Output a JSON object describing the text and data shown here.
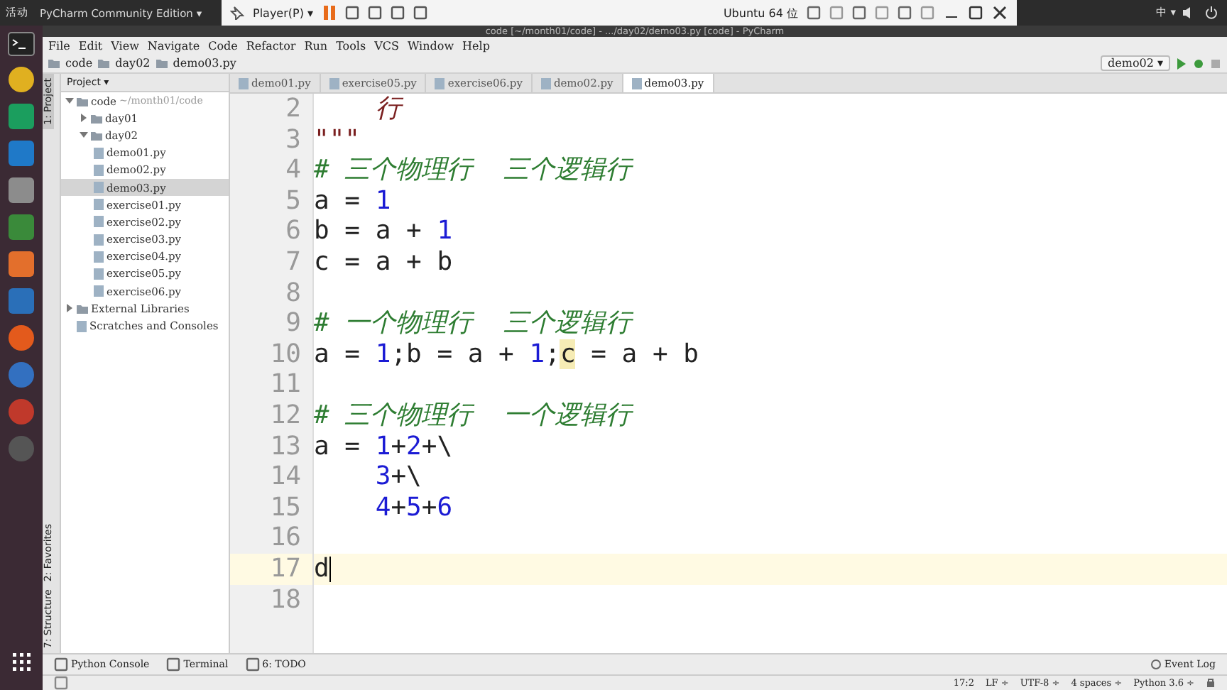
{
  "top_bar": {
    "activities": "活动",
    "app_menu": "PyCharm Community Edition ▾",
    "input_method": "中 ▾"
  },
  "vm_toolbar": {
    "player": "Player(P) ▾",
    "vm_name": "Ubuntu 64 位"
  },
  "window": {
    "title": "code [~/month01/code] - .../day02/demo03.py [code] - PyCharm"
  },
  "menu": [
    "File",
    "Edit",
    "View",
    "Navigate",
    "Code",
    "Refactor",
    "Run",
    "Tools",
    "VCS",
    "Window",
    "Help"
  ],
  "breadcrumb": [
    "code",
    "day02",
    "demo03.py"
  ],
  "run_config": "demo02 ▾",
  "project_header": "Project ▾",
  "side_tabs_left_top": [
    {
      "label": "1: Project",
      "selected": true
    }
  ],
  "side_tabs_left_bottom": [
    {
      "label": "2: Favorites",
      "selected": false
    },
    {
      "label": "7: Structure",
      "selected": false
    }
  ],
  "tree": [
    {
      "label": "code",
      "hint": "~/month01/code",
      "kind": "folder",
      "expanded": true,
      "selected": false,
      "children": [
        {
          "label": "day01",
          "kind": "folder",
          "expanded": false,
          "selected": false
        },
        {
          "label": "day02",
          "kind": "folder",
          "expanded": true,
          "selected": false,
          "children": [
            {
              "label": "demo01.py",
              "kind": "file",
              "selected": false
            },
            {
              "label": "demo02.py",
              "kind": "file",
              "selected": false
            },
            {
              "label": "demo03.py",
              "kind": "file",
              "selected": true
            },
            {
              "label": "exercise01.py",
              "kind": "file",
              "selected": false
            },
            {
              "label": "exercise02.py",
              "kind": "file",
              "selected": false
            },
            {
              "label": "exercise03.py",
              "kind": "file",
              "selected": false
            },
            {
              "label": "exercise04.py",
              "kind": "file",
              "selected": false
            },
            {
              "label": "exercise05.py",
              "kind": "file",
              "selected": false
            },
            {
              "label": "exercise06.py",
              "kind": "file",
              "selected": false
            }
          ]
        }
      ]
    },
    {
      "label": "External Libraries",
      "kind": "library",
      "expanded": false,
      "selected": false
    },
    {
      "label": "Scratches and Consoles",
      "kind": "scratch",
      "selected": false
    }
  ],
  "tabs": [
    {
      "label": "demo01.py",
      "selected": false
    },
    {
      "label": "exercise05.py",
      "selected": false
    },
    {
      "label": "exercise06.py",
      "selected": false
    },
    {
      "label": "demo02.py",
      "selected": false
    },
    {
      "label": "demo03.py",
      "selected": true
    }
  ],
  "code_lines": [
    {
      "number": "2",
      "current": false,
      "tokens": [
        {
          "kind": "string",
          "text": "    行"
        }
      ]
    },
    {
      "number": "3",
      "current": false,
      "tokens": [
        {
          "kind": "string",
          "text": "\"\"\""
        }
      ]
    },
    {
      "number": "4",
      "current": false,
      "tokens": [
        {
          "kind": "comment",
          "text": "# 三个物理行  三个逻辑行"
        }
      ]
    },
    {
      "number": "5",
      "current": false,
      "tokens": [
        {
          "kind": "plain",
          "text": "a = "
        },
        {
          "kind": "number",
          "text": "1"
        }
      ]
    },
    {
      "number": "6",
      "current": false,
      "tokens": [
        {
          "kind": "plain",
          "text": "b = a + "
        },
        {
          "kind": "number",
          "text": "1"
        }
      ]
    },
    {
      "number": "7",
      "current": false,
      "tokens": [
        {
          "kind": "plain",
          "text": "c = a + b"
        }
      ]
    },
    {
      "number": "8",
      "current": false
    },
    {
      "number": "9",
      "current": false,
      "tokens": [
        {
          "kind": "comment",
          "text": "# 一个物理行  三个逻辑行"
        }
      ]
    },
    {
      "number": "10",
      "current": false,
      "tokens": [
        {
          "kind": "plain",
          "text": "a = "
        },
        {
          "kind": "number",
          "text": "1"
        },
        {
          "kind": "plain",
          "text": ";b = a + "
        },
        {
          "kind": "number",
          "text": "1"
        },
        {
          "kind": "plain",
          "text": ";"
        },
        {
          "kind": "match",
          "text": "c"
        },
        {
          "kind": "plain",
          "text": " = a + b"
        }
      ]
    },
    {
      "number": "11",
      "current": false
    },
    {
      "number": "12",
      "current": false,
      "tokens": [
        {
          "kind": "comment",
          "text": "# 三个物理行  一个逻辑行"
        }
      ]
    },
    {
      "number": "13",
      "current": false,
      "tokens": [
        {
          "kind": "plain",
          "text": "a = "
        },
        {
          "kind": "number",
          "text": "1"
        },
        {
          "kind": "plain",
          "text": "+"
        },
        {
          "kind": "number",
          "text": "2"
        },
        {
          "kind": "plain",
          "text": "+\\"
        }
      ]
    },
    {
      "number": "14",
      "current": false,
      "tokens": [
        {
          "kind": "number",
          "text": "    3"
        },
        {
          "kind": "plain",
          "text": "+\\"
        }
      ]
    },
    {
      "number": "15",
      "current": false,
      "tokens": [
        {
          "kind": "number",
          "text": "    4"
        },
        {
          "kind": "plain",
          "text": "+"
        },
        {
          "kind": "number",
          "text": "5"
        },
        {
          "kind": "plain",
          "text": "+"
        },
        {
          "kind": "number",
          "text": "6"
        }
      ]
    },
    {
      "number": "16",
      "current": false
    },
    {
      "number": "17",
      "current": true,
      "tokens": [
        {
          "kind": "plain",
          "text": "d"
        }
      ]
    },
    {
      "number": "18",
      "current": false
    }
  ],
  "bottom_tools": [
    "Python Console",
    "Terminal",
    "6: TODO"
  ],
  "event_log": "Event Log",
  "status_bar": [
    "17:2",
    "LF ÷",
    "UTF-8 ÷",
    "4 spaces ÷",
    "Python 3.6 ÷"
  ]
}
